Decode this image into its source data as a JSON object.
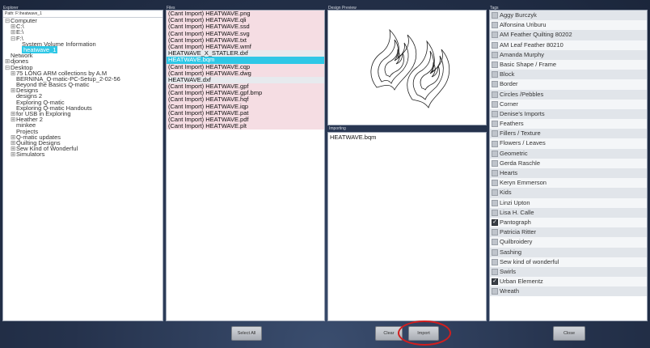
{
  "explorer": {
    "title": "Explorer",
    "path": "Path: F:\\heatwave_1",
    "tree": [
      {
        "exp": "⊟",
        "indent": 0,
        "label": "Computer"
      },
      {
        "exp": "⊞",
        "indent": 1,
        "label": "C:\\"
      },
      {
        "exp": "⊞",
        "indent": 1,
        "label": "E:\\"
      },
      {
        "exp": "⊟",
        "indent": 1,
        "label": "F:\\"
      },
      {
        "exp": "",
        "indent": 2,
        "label": "System Volume Information"
      },
      {
        "exp": "",
        "indent": 2,
        "label": "heatwave_1",
        "selected": true
      },
      {
        "exp": "",
        "indent": 0,
        "label": "Network"
      },
      {
        "exp": "⊞",
        "indent": 0,
        "label": "djones"
      },
      {
        "exp": "⊟",
        "indent": 0,
        "label": "Desktop"
      },
      {
        "exp": "⊞",
        "indent": 1,
        "label": "75 LONG ARM collections by A.M"
      },
      {
        "exp": "",
        "indent": 1,
        "label": "BERNINA_Q-matic-PC-Setup_2-02-56"
      },
      {
        "exp": "",
        "indent": 1,
        "label": "Beyond the Basics Q-matic"
      },
      {
        "exp": "⊞",
        "indent": 1,
        "label": "Designs"
      },
      {
        "exp": "",
        "indent": 1,
        "label": "designs 2"
      },
      {
        "exp": "",
        "indent": 1,
        "label": "Exploring Q-matic"
      },
      {
        "exp": "",
        "indent": 1,
        "label": "Exploring Q-matic Handouts"
      },
      {
        "exp": "⊞",
        "indent": 1,
        "label": "for USB in Exploring"
      },
      {
        "exp": "⊞",
        "indent": 1,
        "label": "Heather 2"
      },
      {
        "exp": "",
        "indent": 1,
        "label": "minkee"
      },
      {
        "exp": "",
        "indent": 1,
        "label": "Projects"
      },
      {
        "exp": "⊞",
        "indent": 1,
        "label": "Q-matic updates"
      },
      {
        "exp": "⊞",
        "indent": 1,
        "label": "Quilting Designs"
      },
      {
        "exp": "⊞",
        "indent": 1,
        "label": "Sew Kind of Wonderful"
      },
      {
        "exp": "⊞",
        "indent": 1,
        "label": "Simulators"
      }
    ]
  },
  "files": {
    "title": "Files",
    "items": [
      {
        "name": "(Cant Import) HEATWAVE.png",
        "kind": "cant"
      },
      {
        "name": "(Cant Import) HEATWAVE.qli",
        "kind": "cant"
      },
      {
        "name": "(Cant Import) HEATWAVE.ssd",
        "kind": "cant"
      },
      {
        "name": "(Cant Import) HEATWAVE.svg",
        "kind": "cant"
      },
      {
        "name": "(Cant Import) HEATWAVE.txt",
        "kind": "cant"
      },
      {
        "name": "(Cant Import) HEATWAVE.wmf",
        "kind": "cant"
      },
      {
        "name": "HEATWAVE_X_STATLER.dxf",
        "kind": "normal"
      },
      {
        "name": "HEATWAVE.bqm",
        "kind": "selected"
      },
      {
        "name": "(Cant Import) HEATWAVE.cqp",
        "kind": "cant"
      },
      {
        "name": "(Cant Import) HEATWAVE.dwg",
        "kind": "cant"
      },
      {
        "name": "HEATWAVE.dxf",
        "kind": "normal"
      },
      {
        "name": "(Cant Import) HEATWAVE.gpf",
        "kind": "cant"
      },
      {
        "name": "(Cant Import) HEATWAVE.gpf.bmp",
        "kind": "cant"
      },
      {
        "name": "(Cant Import) HEATWAVE.hqf",
        "kind": "cant"
      },
      {
        "name": "(Cant Import) HEATWAVE.iqp",
        "kind": "cant"
      },
      {
        "name": "(Cant Import) HEATWAVE.pat",
        "kind": "cant"
      },
      {
        "name": "(Cant Import) HEATWAVE.pdf",
        "kind": "cant"
      },
      {
        "name": "(Cant Import) HEATWAVE.plt",
        "kind": "cant"
      }
    ]
  },
  "preview": {
    "title": "Design Preview"
  },
  "importing": {
    "title": "Importing",
    "file": "HEATWAVE.bqm"
  },
  "tags": {
    "title": "Tags",
    "items": [
      {
        "label": "Aggy Burczyk",
        "checked": false
      },
      {
        "label": "Alfonsina Uriburu",
        "checked": false
      },
      {
        "label": "AM Feather Quilting 80202",
        "checked": false
      },
      {
        "label": "AM Leaf Feather 80210",
        "checked": false
      },
      {
        "label": "Amanda Murphy",
        "checked": false
      },
      {
        "label": "Basic Shape / Frame",
        "checked": false
      },
      {
        "label": "Block",
        "checked": false
      },
      {
        "label": "Border",
        "checked": false
      },
      {
        "label": "Circles /Pebbles",
        "checked": false
      },
      {
        "label": "Corner",
        "checked": false
      },
      {
        "label": "Denise's Imports",
        "checked": false
      },
      {
        "label": "Feathers",
        "checked": false
      },
      {
        "label": "Fillers / Texture",
        "checked": false
      },
      {
        "label": "Flowers / Leaves",
        "checked": false
      },
      {
        "label": "Geometric",
        "checked": false
      },
      {
        "label": "Gerda Raschle",
        "checked": false
      },
      {
        "label": "Hearts",
        "checked": false
      },
      {
        "label": "Keryn Emmerson",
        "checked": false
      },
      {
        "label": "Kids",
        "checked": false
      },
      {
        "label": "Linzi Upton",
        "checked": false
      },
      {
        "label": "Lisa H. Calle",
        "checked": false
      },
      {
        "label": "Pantograph",
        "checked": true
      },
      {
        "label": "Patricia Ritter",
        "checked": false
      },
      {
        "label": "Quilbroidery",
        "checked": false
      },
      {
        "label": "Sashing",
        "checked": false
      },
      {
        "label": "Sew kind of wonderful",
        "checked": false
      },
      {
        "label": "Swirls",
        "checked": false
      },
      {
        "label": "Urban Elementz",
        "checked": true
      },
      {
        "label": "Wreath",
        "checked": false
      }
    ]
  },
  "buttons": {
    "select_all": "Select All",
    "clear": "Clear",
    "import": "Import",
    "close": "Close"
  },
  "colors": {
    "selection": "#2ec7e6",
    "cant_import_row": "#f5dde3",
    "highlight_ring": "#d21e1e"
  }
}
